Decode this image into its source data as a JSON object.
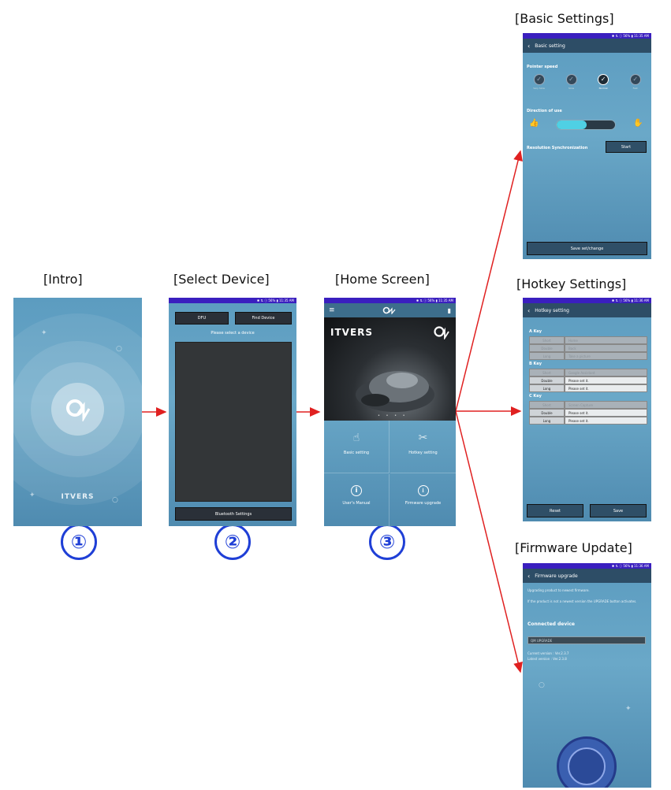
{
  "captions": {
    "basic": "[Basic Settings]",
    "intro": "[Intro]",
    "select": "[Select Device]",
    "home": "[Home Screen]",
    "hotkey": "[Hotkey Settings]",
    "firmware": "[Firmware Update]"
  },
  "steps": [
    "①",
    "②",
    "③"
  ],
  "colors": {
    "arrow": "#e02020",
    "step_circle": "#1f3fd6",
    "status_bar": "#3a1fbf"
  },
  "intro": {
    "brand": "ITVERS"
  },
  "select_device": {
    "status": "✱ ⇅ ⓘ 56% ▮ 11:35 AM",
    "dfu_label": "DFU",
    "find_label": "Find Device",
    "prompt": "Please select a device",
    "bt_settings_label": "Bluetooth Settings"
  },
  "home": {
    "status": "✱ ⇅ ⓘ 56% ▮ 11:35 AM",
    "logo_text": "ITVERS",
    "basic_label": "Basic setting",
    "hotkey_label": "Hotkey setting",
    "manual_label": "User's Manual",
    "firmware_label": "Firmware upgrade"
  },
  "basic_settings": {
    "status": "✱ ⇅ ⓘ 56% ▮ 11:35 AM",
    "title": "Basic setting",
    "pointer_speed": "Pointer speed",
    "speeds": [
      "Very Slow",
      "Slow",
      "Normal",
      "Fast"
    ],
    "direction": "Direction of use",
    "resolution": "Resolution Synchronization",
    "start_label": "Start",
    "save_label": "Save set/change"
  },
  "hotkey_settings": {
    "status": "✱ ⇅ ⓘ 56% ▮ 11:36 AM",
    "title": "Hotkey setting",
    "keys": [
      {
        "name": "A Key",
        "rows": [
          {
            "press": "Short",
            "action": "Home",
            "dim": true
          },
          {
            "press": "Double",
            "action": "Back",
            "dim": true
          },
          {
            "press": "Long",
            "action": "Take a picture",
            "dim": true
          }
        ]
      },
      {
        "name": "B Key",
        "rows": [
          {
            "press": "Short",
            "action": "Google Assistant",
            "dim": true
          },
          {
            "press": "Double",
            "action": "Please set it.",
            "dim": false
          },
          {
            "press": "Long",
            "action": "Please set it.",
            "dim": false
          }
        ]
      },
      {
        "name": "C Key",
        "rows": [
          {
            "press": "Short",
            "action": "Screen Capture",
            "dim": true
          },
          {
            "press": "Double",
            "action": "Please set it.",
            "dim": false
          },
          {
            "press": "Long",
            "action": "Please set it.",
            "dim": false
          }
        ]
      }
    ],
    "reset_label": "Reset",
    "save_label": "Save"
  },
  "firmware_update": {
    "status": "✱ ⇅ ⓘ 56% ▮ 11:36 AM",
    "title": "Firmware upgrade",
    "desc1": "Upgrading product to newest firmware.",
    "desc2": "If the product is not a newest version the UPGRADE button activates.",
    "connected": "Connected device",
    "device_name": "QM UPGRADE",
    "current": "Current version : Ver.2.3.7",
    "latest": "Latest version : Ver.2.3.8"
  }
}
